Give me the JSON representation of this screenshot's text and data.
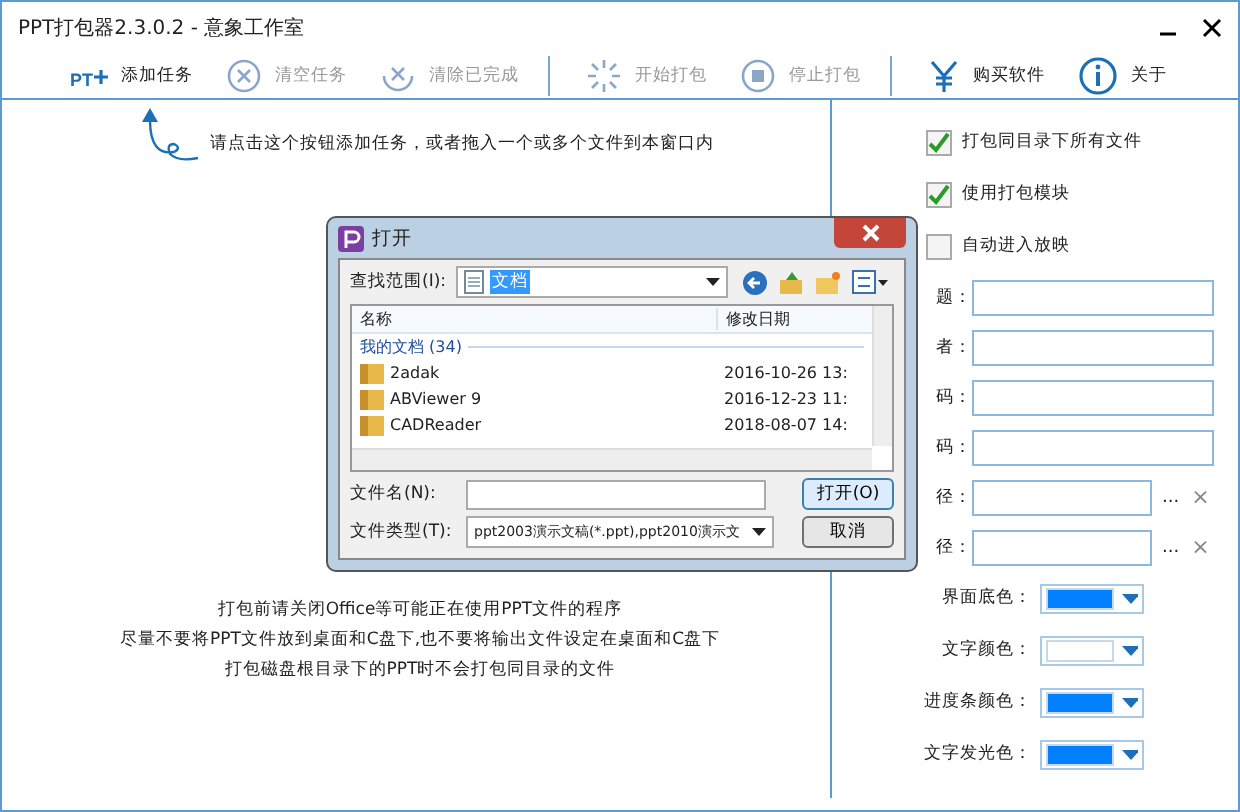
{
  "window": {
    "title": "PPT打包器2.3.0.2 - 意象工作室"
  },
  "toolbar": [
    {
      "kind": "add",
      "label": "添加任务",
      "disabled": false,
      "icon_text": "PT"
    },
    {
      "kind": "clear",
      "label": "清空任务",
      "disabled": true
    },
    {
      "kind": "remove",
      "label": "清除已完成",
      "disabled": true
    },
    {
      "kind": "sep"
    },
    {
      "kind": "start",
      "label": "开始打包",
      "disabled": true
    },
    {
      "kind": "stop",
      "label": "停止打包",
      "disabled": true
    },
    {
      "kind": "sep"
    },
    {
      "kind": "buy",
      "label": "购买软件",
      "disabled": false
    },
    {
      "kind": "about",
      "label": "关于",
      "disabled": false
    }
  ],
  "hint": "请点击这个按钮添加任务，或者拖入一个或多个文件到本窗口内",
  "notes": [
    "打包前请关闭Office等可能正在使用PPT文件的程序",
    "尽量不要将PPT文件放到桌面和C盘下,也不要将输出文件设定在桌面和C盘下",
    "打包磁盘根目录下的PPT时不会打包同目录的文件"
  ],
  "settings": {
    "checkboxes": [
      {
        "label": "打包同目录下所有文件",
        "checked": true
      },
      {
        "label": "使用打包模块",
        "checked": true
      },
      {
        "label": "自动进入放映",
        "checked": false
      }
    ],
    "fields": [
      {
        "kind": "text",
        "label": "题："
      },
      {
        "kind": "text",
        "label": "者："
      },
      {
        "kind": "text",
        "label": "码："
      },
      {
        "kind": "text",
        "label": "码："
      },
      {
        "kind": "path",
        "label": "径：",
        "browse": "...",
        "clear": "×"
      },
      {
        "kind": "path",
        "label": "径：",
        "browse": "...",
        "clear": "×"
      }
    ],
    "colors": [
      {
        "label": "界面底色：",
        "color": "#0080ff"
      },
      {
        "label": "文字颜色：",
        "color": "#ffffff"
      },
      {
        "label": "进度条颜色：",
        "color": "#0080ff"
      },
      {
        "label": "文字发光色：",
        "color": "#0080ff"
      }
    ]
  },
  "dialog": {
    "title": "打开",
    "look_in_label": "查找范围(I):",
    "look_in_value": "文档",
    "columns": [
      "名称",
      "修改日期"
    ],
    "group": "我的文档 (34)",
    "rows": [
      {
        "name": "2adak",
        "date": "2016-10-26 13:"
      },
      {
        "name": "ABViewer 9",
        "date": "2016-12-23 11:"
      },
      {
        "name": "CADReader",
        "date": "2018-08-07 14:"
      }
    ],
    "filename_label": "文件名(N):",
    "filetype_label": "文件类型(T):",
    "filetype_value": "ppt2003演示文稿(*.ppt),ppt2010演示文",
    "open_button": "打开(O)",
    "cancel_button": "取消"
  }
}
